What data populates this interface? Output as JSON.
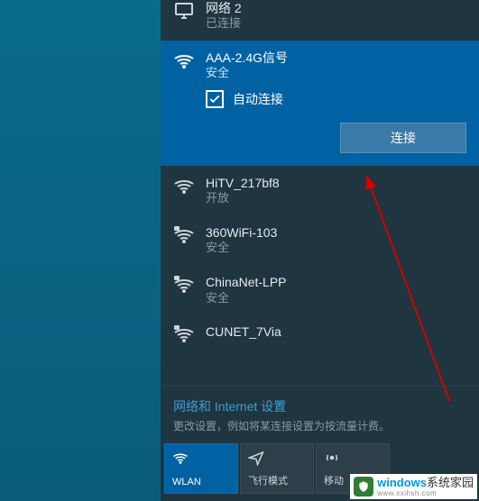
{
  "networks": {
    "ethernet": {
      "name": "网络 2",
      "sub": "已连接"
    },
    "selected": {
      "name": "AAA-2.4G信号",
      "sub": "安全",
      "auto": "自动连接",
      "connect": "连接"
    },
    "list": [
      {
        "name": "HiTV_217bf8",
        "sub": "开放",
        "secure": false
      },
      {
        "name": "360WiFi-103",
        "sub": "安全",
        "secure": true
      },
      {
        "name": "ChinaNet-LPP",
        "sub": "安全",
        "secure": true
      },
      {
        "name": "CUNET_7Via",
        "sub": "",
        "secure": true
      }
    ]
  },
  "settings": {
    "link": "网络和 Internet 设置",
    "desc": "更改设置，例如将某连接设置为按流量计费。"
  },
  "bottom": {
    "wlan": "WLAN",
    "airplane": "飞行模式",
    "hotspot": "移动"
  },
  "watermark": {
    "text1": "windows",
    "text2": "系统家园",
    "sub": "www.xxihsh.com"
  }
}
